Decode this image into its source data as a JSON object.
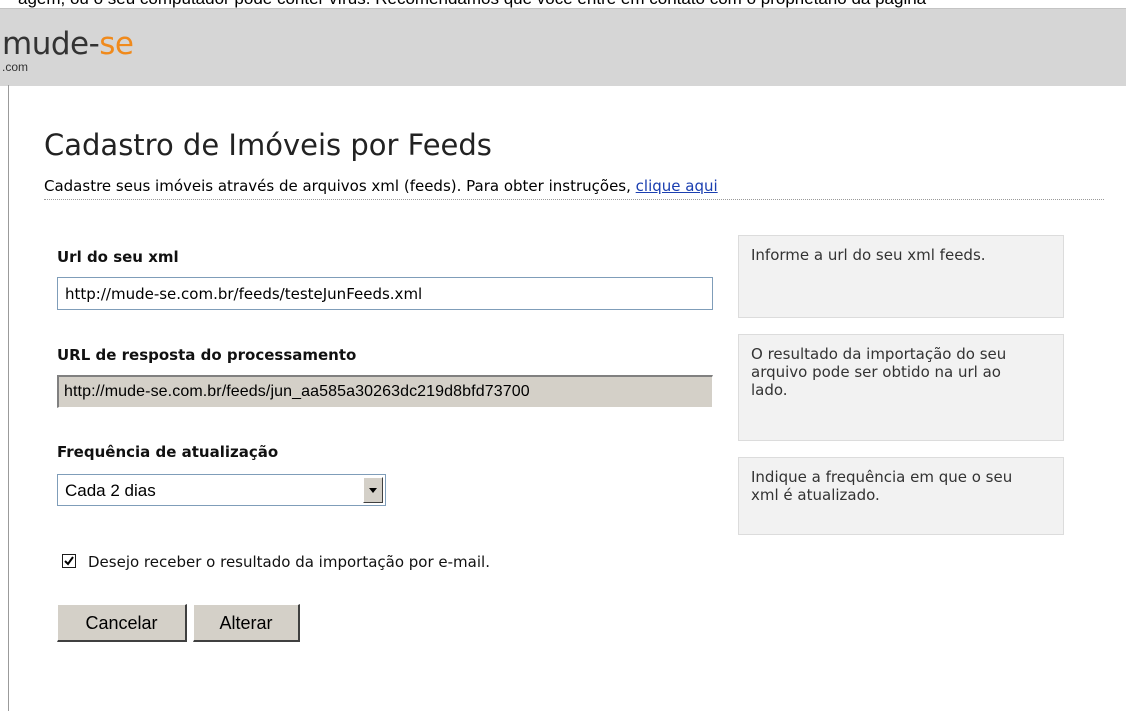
{
  "top_fragment": "agem, ou o seu computador pode conter vírus. Recomendamos que você entre em contato com o proprietário da página",
  "logo": {
    "word": "mude-",
    "accent": "se",
    "tld": ".com"
  },
  "page": {
    "title": "Cadastro de Imóveis por Feeds",
    "subtitle": "Cadastre seus imóveis através de arquivos xml (feeds). Para obter instruções,",
    "subtitle_link": "clique aqui"
  },
  "form": {
    "xml_url": {
      "label": "Url do seu xml",
      "value": "http://mude-se.com.br/feeds/testeJunFeeds.xml",
      "hint": "Informe a url do seu xml feeds."
    },
    "response_url": {
      "label": "URL de resposta do processamento",
      "value": "http://mude-se.com.br/feeds/jun_aa585a30263dc219d8bfd73700",
      "hint": "O resultado da importação do seu arquivo pode ser obtido na url ao lado."
    },
    "frequency": {
      "label": "Frequência de atualização",
      "selected": "Cada 2 dias",
      "hint": "Indique a frequência em que o seu xml é atualizado."
    },
    "email_checkbox": {
      "label": "Desejo receber o resultado da importação por e-mail.",
      "checked": true
    },
    "buttons": {
      "cancel": "Cancelar",
      "submit": "Alterar"
    }
  }
}
